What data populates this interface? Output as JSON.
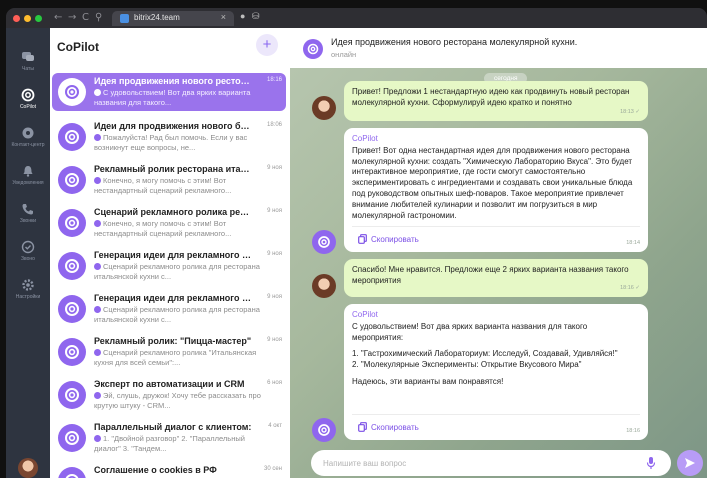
{
  "browser": {
    "tab_title": "bitrix24.team",
    "tab_close": "×",
    "nav_symbols": [
      "←",
      "→",
      "C",
      "⚲"
    ]
  },
  "rail": {
    "items": [
      {
        "label": "Чаты",
        "icon": "chat-icon"
      },
      {
        "label": "CoPilot",
        "icon": "copilot-icon"
      },
      {
        "label": "Контакт-центр",
        "icon": "contact-center-icon"
      },
      {
        "label": "Уведомления",
        "icon": "bell-icon"
      },
      {
        "label": "Звонки",
        "icon": "phone-icon"
      },
      {
        "label": "Звоно",
        "icon": "check-icon"
      },
      {
        "label": "Настройки",
        "icon": "settings-icon"
      }
    ]
  },
  "list": {
    "title": "CoPilot",
    "add_symbol": "+",
    "chats": [
      {
        "name": "Идея продвижения нового ресторана",
        "time": "18:16",
        "preview": "С удовольствием! Вот два ярких варианта названия для такого..."
      },
      {
        "name": "Идеи для продвижения нового бренда",
        "time": "18:06",
        "preview": "Пожалуйста! Рад был помочь. Если у вас возникнут еще вопросы, не..."
      },
      {
        "name": "Рекламный ролик ресторана итальянской",
        "time": "9 ноя",
        "preview": "Конечно, я могу помочь с этим! Вот нестандартный сценарий рекламного..."
      },
      {
        "name": "Сценарий рекламного ролика ресторана",
        "time": "9 ноя",
        "preview": "Конечно, я могу помочь с этим! Вот нестандартный сценарий рекламного..."
      },
      {
        "name": "Генерация идеи для рекламного ролика",
        "time": "9 ноя",
        "preview": "Сценарий рекламного ролика для ресторана итальянской кухни с..."
      },
      {
        "name": "Генерация идеи для рекламного ролика",
        "time": "9 ноя",
        "preview": "Сценарий рекламного ролика для ресторана итальянской кухни с..."
      },
      {
        "name": "Рекламный ролик: \"Пицца-мастер\"",
        "time": "9 ноя",
        "preview": "Сценарий рекламного ролика \"Итальянская кухня для всей семьи\":..."
      },
      {
        "name": "Эксперт по автоматизации и CRM",
        "time": "6 ноя",
        "preview": "Эй, слушь, дружок! Хочу тебе рассказать про крутую штуку - CRM..."
      },
      {
        "name": "Параллельный диалог с клиентом:",
        "time": "4 окт",
        "preview": "1. \"Двойной разговор\" 2. \"Параллельный диалог\" 3. \"Тандем..."
      },
      {
        "name": "Соглашение о cookies в РФ",
        "time": "30 сен",
        "preview": "Мы используем cookies на нашем сайте для обеспечения его..."
      }
    ]
  },
  "pane": {
    "title": "Идея продвижения нового ресторана молекулярной кухни.",
    "status": "онлайн",
    "date": "сегодня",
    "messages": [
      {
        "side": "out",
        "text": "Привет! Предложи 1 нестандартную идею как продвинуть новый ресторан молекулярной кухни. Сформулируй идею кратко и понятно",
        "time": "18:13"
      },
      {
        "side": "in",
        "from": "CoPilot",
        "text": "Привет! Вот одна нестандартная идея для продвижения нового ресторана молекулярной кухни: создать \"Химическую Лабораторию Вкуса\". Это будет интерактивное мероприятие, где гости смогут самостоятельно экспериментировать с ингредиентами и создавать свои уникальные блюда под руководством опытных шеф-поваров. Такое мероприятие привлечет внимание любителей кулинарии и позволит им погрузиться в мир молекулярной гастрономии.",
        "time": "18:14",
        "copy": "Скопировать"
      },
      {
        "side": "out",
        "text": "Спасибо! Мне нравится. Предложи еще 2 ярких варианта названия такого мероприятия",
        "time": "18:16"
      },
      {
        "side": "in",
        "from": "CoPilot",
        "lines": [
          "С удовольствием! Вот два ярких варианта названия для такого мероприятия:",
          "1. \"Гастрохимический Лабораториум: Исследуй, Создавай, Удивляйся!\"",
          "2. \"Молекулярные Эксперименты: Открытие Вкусового Мира\"",
          "Надеюсь, эти варианты вам понравятся!"
        ],
        "time": "18:16",
        "copy": "Скопировать"
      }
    ],
    "input_placeholder": "Напишите ваш вопрос"
  },
  "colors": {
    "accent": "#8f66ee",
    "active_chat": "#9a73ec",
    "outgoing": "#e6f8c6",
    "rail": "#2e3440"
  }
}
